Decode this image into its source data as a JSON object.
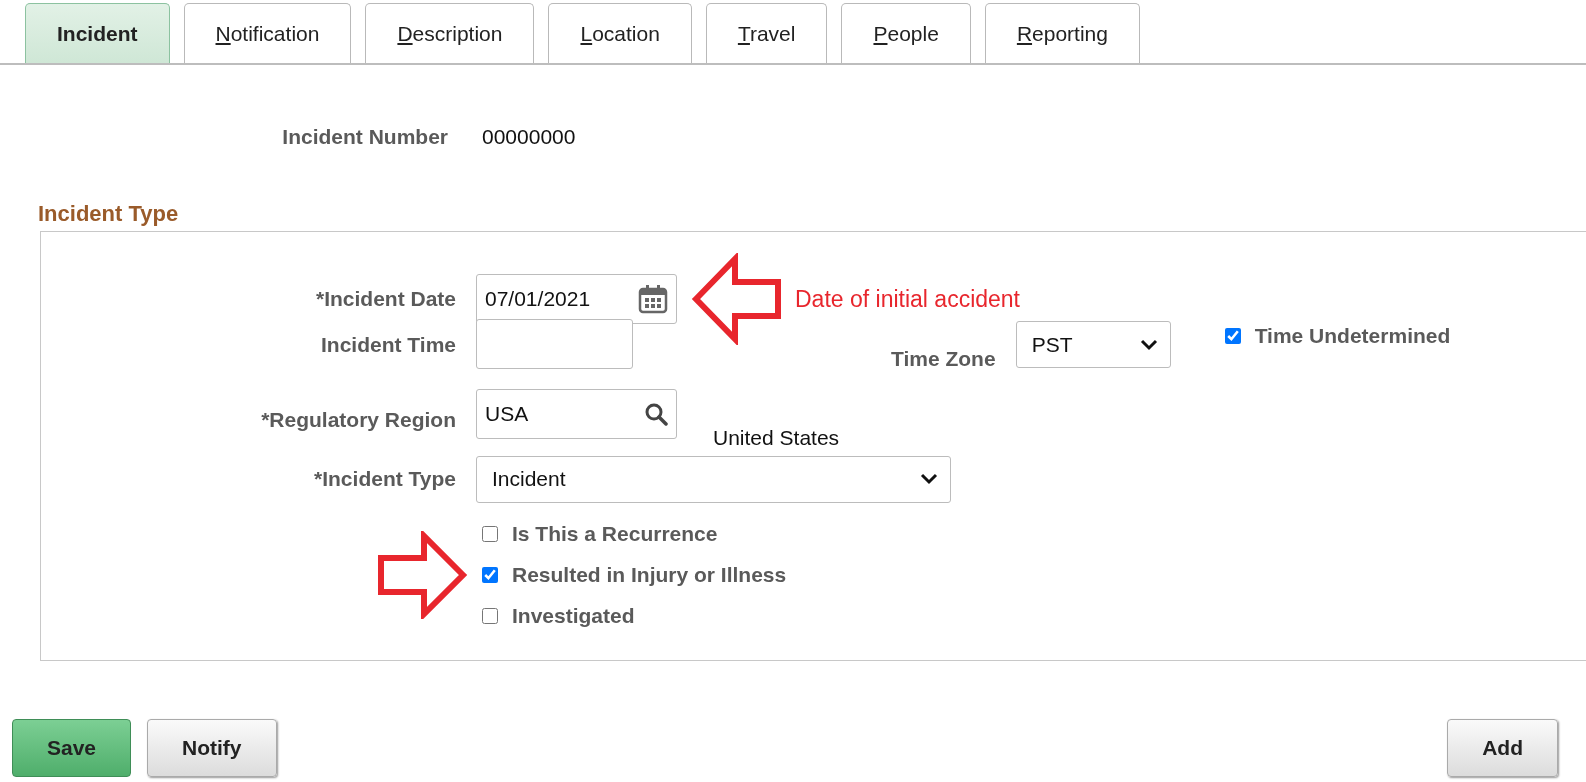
{
  "tabs": [
    {
      "label": "Incident",
      "selected": true,
      "access_key_underlined": false
    },
    {
      "label": "Notification",
      "selected": false,
      "access_key_underlined": true
    },
    {
      "label": "Description",
      "selected": false,
      "access_key_underlined": true
    },
    {
      "label": "Location",
      "selected": false,
      "access_key_underlined": true
    },
    {
      "label": "Travel",
      "selected": false,
      "access_key_underlined": true
    },
    {
      "label": "People",
      "selected": false,
      "access_key_underlined": true
    },
    {
      "label": "Reporting",
      "selected": false,
      "access_key_underlined": true
    }
  ],
  "incident_number": {
    "label": "Incident Number",
    "value": "00000000"
  },
  "incident_type_section": {
    "title": "Incident Type",
    "incident_date": {
      "label": "*Incident Date",
      "value": "07/01/2021"
    },
    "date_annotation": {
      "text": "Date of initial accident"
    },
    "incident_time": {
      "label": "Incident Time"
    },
    "time_zone": {
      "label": "Time Zone",
      "value": "PST"
    },
    "time_undetermined": {
      "label": "Time Undetermined",
      "checked": true
    },
    "regulatory_region": {
      "label": "*Regulatory Region",
      "value": "USA",
      "description": "United States"
    },
    "incident_type": {
      "label": "*Incident Type",
      "value": "Incident"
    },
    "checkboxes": [
      {
        "label": "Is This a Recurrence",
        "checked": false
      },
      {
        "label": "Resulted in Injury or Illness",
        "checked": true
      },
      {
        "label": "Investigated",
        "checked": false
      }
    ]
  },
  "button_bar": {
    "left": [
      {
        "label": "Save",
        "kind": "primary"
      },
      {
        "label": "Notify",
        "kind": "secondary"
      }
    ],
    "right": [
      {
        "label": "Add",
        "kind": "secondary"
      }
    ]
  }
}
